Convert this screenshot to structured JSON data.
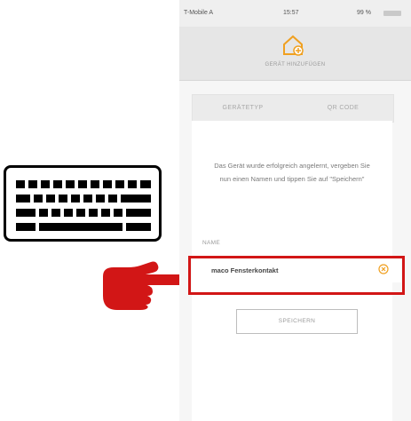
{
  "status_bar": {
    "carrier": "T-Mobile A",
    "time": "15:57",
    "battery": "99 %"
  },
  "header": {
    "title": "GERÄT HINZUFÜGEN",
    "icon": "add-device-icon"
  },
  "tabs": [
    {
      "label": "GERÄTETYP"
    },
    {
      "label": "QR CODE"
    }
  ],
  "message": "Das Gerät wurde erfolgreich angelernt, vergeben Sie nun einen Namen und tippen Sie auf \"Speichern\"",
  "name_field": {
    "label": "NAME",
    "value": "maco Fensterkontakt",
    "clear_icon": "clear-circle-icon"
  },
  "save_button": {
    "label": "SPEICHERN"
  },
  "annotations": {
    "keyboard_icon": "keyboard-icon",
    "pointer_icon": "pointing-hand-icon",
    "highlight_color": "#d21616"
  },
  "colors": {
    "header_bg": "#e6e6e6",
    "accent_orange": "#f0a020"
  }
}
